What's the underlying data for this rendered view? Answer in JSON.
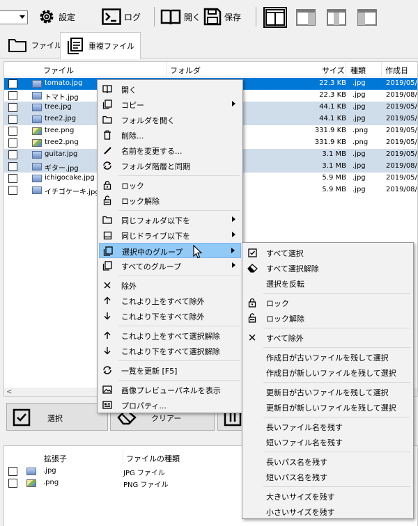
{
  "toolbar": {
    "settings_label": "設定",
    "log_label": "ログ",
    "open_label": "開く",
    "save_label": "保存"
  },
  "tabs": [
    {
      "label": "ファイル"
    },
    {
      "label": "重複ファイル"
    }
  ],
  "file_list": {
    "columns": {
      "file": "ファイル",
      "folder": "フォルダ",
      "size": "サイズ",
      "type": "種類",
      "created": "作成日"
    },
    "rows": [
      {
        "name": "tomato.jpg",
        "size": "22.3 KB",
        "type": ".jpg",
        "date": "2019/05/"
      },
      {
        "name": "トマト.jpg",
        "size": "22.3 KB",
        "type": ".jpg",
        "date": "2019/08/"
      },
      {
        "name": "tree.jpg",
        "size": "44.1 KB",
        "type": ".jpg",
        "date": "2019/05/"
      },
      {
        "name": "tree2.jpg",
        "size": "44.1 KB",
        "type": ".jpg",
        "date": "2019/05/"
      },
      {
        "name": "tree.png",
        "size": "331.9 KB",
        "type": ".png",
        "date": "2019/05/"
      },
      {
        "name": "tree2.png",
        "size": "331.9 KB",
        "type": ".png",
        "date": "2019/05/"
      },
      {
        "name": "guitar.jpg",
        "size": "3.1 MB",
        "type": ".jpg",
        "date": "2019/05/"
      },
      {
        "name": "ギター.jpg",
        "size": "3.1 MB",
        "type": ".jpg",
        "date": "2019/08/"
      },
      {
        "name": "ichigocake.jpg",
        "size": "5.9 MB",
        "type": ".jpg",
        "date": "2019/05/"
      },
      {
        "name": "イチゴケーキ.jpg",
        "size": "5.9 MB",
        "type": ".jpg",
        "date": "2019/08/"
      }
    ]
  },
  "bottom_buttons": {
    "select_label": "選択",
    "clear_label": "クリアー"
  },
  "ext_list": {
    "columns": {
      "ext": "拡張子",
      "type": "ファイルの種類"
    },
    "rows": [
      {
        "ext": ".jpg",
        "type": "JPG ファイル"
      },
      {
        "ext": ".png",
        "type": "PNG ファイル"
      }
    ]
  },
  "context_menu": {
    "open": "開く",
    "copy": "コピー",
    "open_folder": "フォルダを開く",
    "delete": "削除...",
    "rename": "名前を変更する...",
    "sync_folder": "フォルダ階層と同期",
    "lock": "ロック",
    "unlock": "ロック解除",
    "same_folder": "同じフォルダ以下を",
    "same_drive": "同じドライブ以下を",
    "selected_group": "選択中のグループ",
    "all_groups": "すべてのグループ",
    "exclude": "除外",
    "exclude_above": "これより上をすべて除外",
    "exclude_below": "これより下をすべて除外",
    "deselect_above": "これより上をすべて選択解除",
    "deselect_below": "これより下をすべて選択解除",
    "refresh": "一覧を更新 [F5]",
    "show_preview": "画像プレビューパネルを表示",
    "properties": "プロパティ..."
  },
  "submenu": {
    "select_all": "すべて選択",
    "deselect_all": "すべて選択解除",
    "invert": "選択を反転",
    "lock": "ロック",
    "unlock": "ロック解除",
    "exclude_all": "すべて除外",
    "keep_oldest_created": "作成日が古いファイルを残して選択",
    "keep_newest_created": "作成日が新しいファイルを残して選択",
    "keep_oldest_modified": "更新日が古いファイルを残して選択",
    "keep_newest_modified": "更新日が新しいファイルを残して選択",
    "keep_long_name": "長いファイル名を残す",
    "keep_short_name": "短いファイル名を残す",
    "keep_long_path": "長いパス名を残す",
    "keep_short_path": "短いパス名を残す",
    "keep_large": "大きいサイズを残す",
    "keep_small": "小さいサイズを残す"
  },
  "colors": {
    "selection": "#0078d7",
    "group_row": "#cfdcea",
    "menu_highlight": "#91c9f7"
  }
}
